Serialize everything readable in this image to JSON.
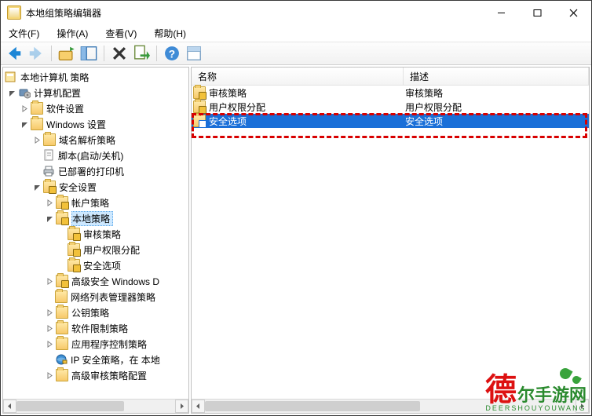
{
  "title": "本地组策略编辑器",
  "menus": {
    "file": "文件(F)",
    "action": "操作(A)",
    "view": "查看(V)",
    "help": "帮助(H)"
  },
  "tree": {
    "root": "本地计算机 策略",
    "computer_config": "计算机配置",
    "software_settings": "软件设置",
    "windows_settings": "Windows 设置",
    "name_res_policy": "域名解析策略",
    "scripts": "脚本(启动/关机)",
    "deployed_printers": "已部署的打印机",
    "security_settings": "安全设置",
    "account_policies": "帐户策略",
    "local_policies": "本地策略",
    "audit_policy": "审核策略",
    "user_rights": "用户权限分配",
    "security_options": "安全选项",
    "adv_firewall": "高级安全 Windows D",
    "nlm_policies": "网络列表管理器策略",
    "public_key": "公钥策略",
    "software_restrict": "软件限制策略",
    "app_control": "应用程序控制策略",
    "ip_security": "IP 安全策略，在 本地",
    "adv_audit": "高级审核策略配置"
  },
  "list": {
    "col_name": "名称",
    "col_desc": "描述",
    "rows": [
      {
        "name": "审核策略",
        "desc": "审核策略"
      },
      {
        "name": "用户权限分配",
        "desc": "用户权限分配"
      },
      {
        "name": "安全选项",
        "desc": "安全选项"
      }
    ],
    "selected_index": 2
  },
  "watermark": {
    "big_first": "德",
    "big_rest": "尔手游网",
    "sub": "DEERSHOUYOUWANG"
  }
}
